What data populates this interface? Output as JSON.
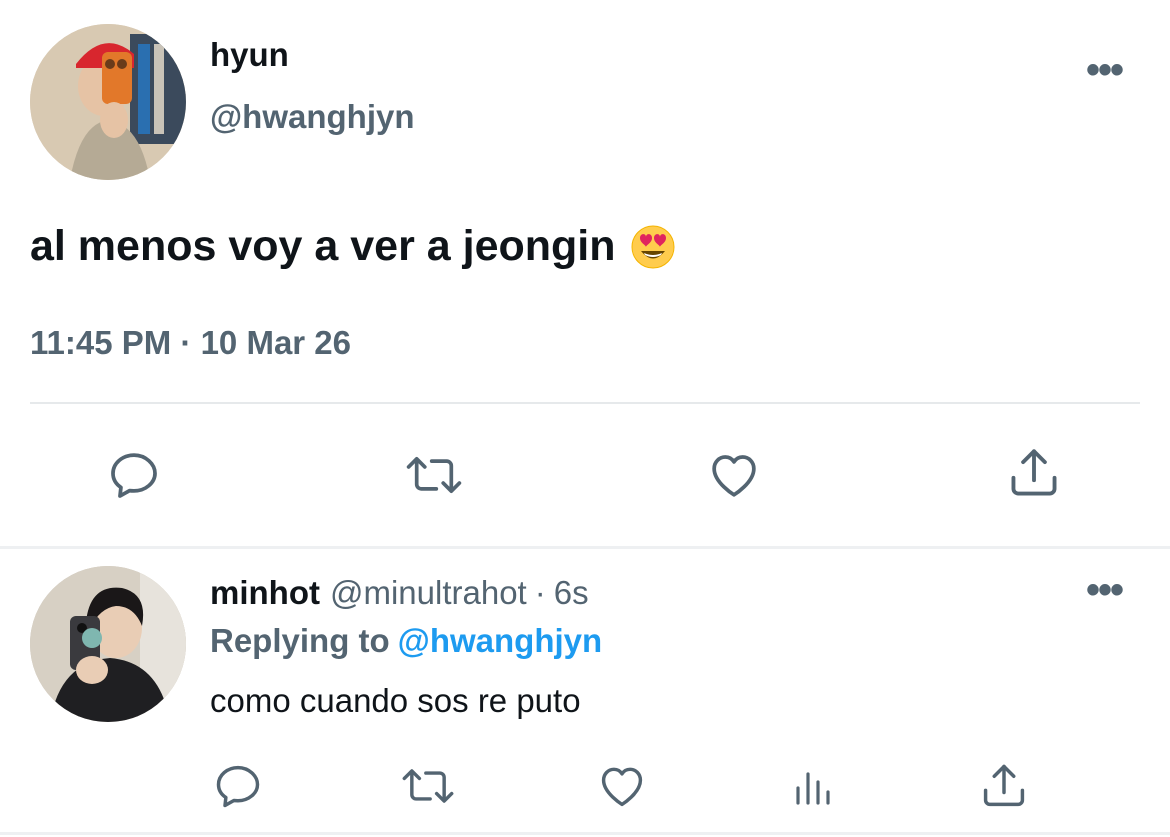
{
  "main_tweet": {
    "display_name": "hyun",
    "handle": "@hwanghjyn",
    "text": "al menos voy a ver a jeongin",
    "emoji": "smiling-face-with-heart-eyes",
    "timestamp": "11:45 PM · 10 Mar 26",
    "more_label": "•••"
  },
  "reply_tweet": {
    "display_name": "minhot",
    "handle": "@minultrahot",
    "separator": "·",
    "time_ago": "6s",
    "replying_label": "Replying to",
    "replying_handle": "@hwanghjyn",
    "text": "como cuando sos re puto",
    "more_label": "•••"
  },
  "icons": {
    "reply": "reply-icon",
    "retweet": "retweet-icon",
    "like": "heart-icon",
    "share": "share-icon",
    "views": "views-icon",
    "more": "more-icon"
  },
  "colors": {
    "text_primary": "#0f1419",
    "text_secondary": "#536471",
    "link": "#1d9bf0",
    "divider": "#e6e9eb"
  }
}
